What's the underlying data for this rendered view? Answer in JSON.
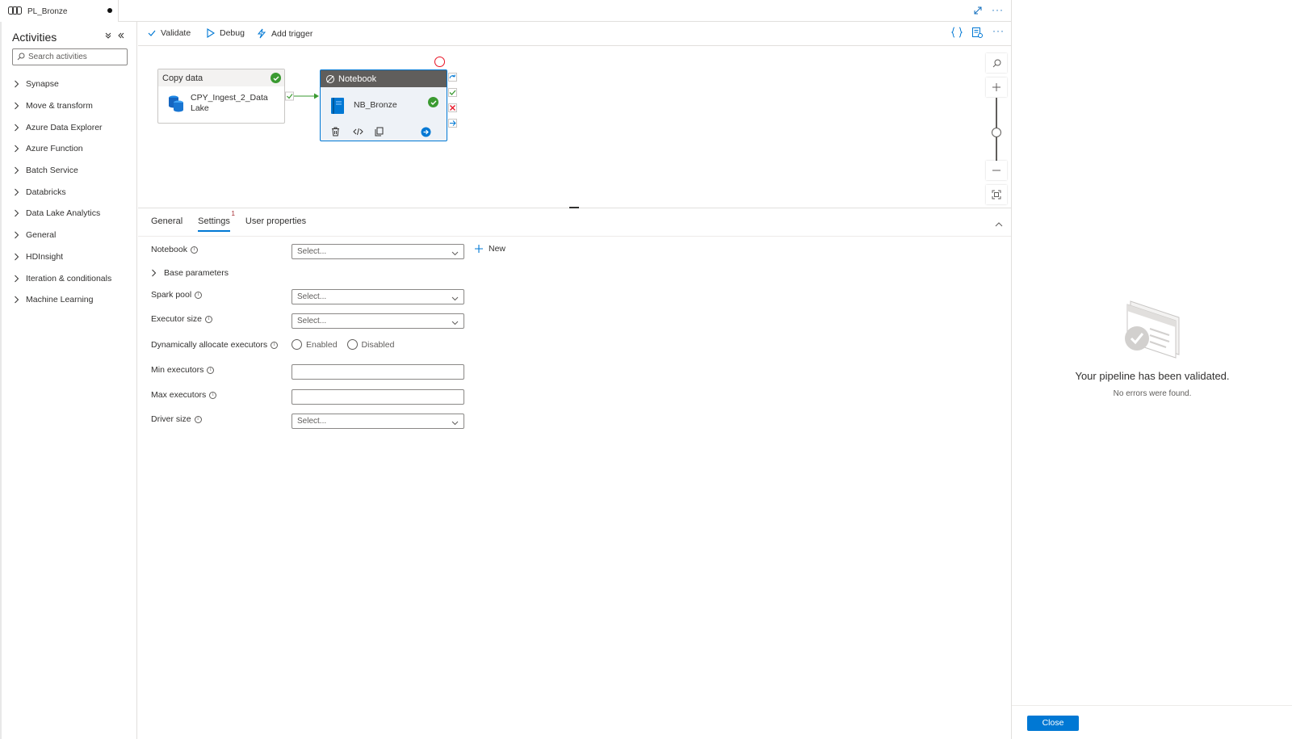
{
  "tab": {
    "name": "PL_Bronze"
  },
  "activities": {
    "title": "Activities",
    "search_placeholder": "Search activities",
    "groups": [
      "Synapse",
      "Move & transform",
      "Azure Data Explorer",
      "Azure Function",
      "Batch Service",
      "Databricks",
      "Data Lake Analytics",
      "General",
      "HDInsight",
      "Iteration & conditionals",
      "Machine Learning"
    ]
  },
  "toolbar": {
    "validate": "Validate",
    "debug": "Debug",
    "add_trigger": "Add trigger"
  },
  "canvas": {
    "copy_activity": {
      "type": "Copy data",
      "name": "CPY_Ingest_2_Data Lake"
    },
    "notebook_activity": {
      "type": "Notebook",
      "name": "NB_Bronze"
    }
  },
  "properties": {
    "tabs": {
      "general": "General",
      "settings": "Settings",
      "settings_errors": "1",
      "user_properties": "User properties"
    },
    "notebook_label": "Notebook",
    "notebook_value": "Select...",
    "new_label": "New",
    "base_parameters": "Base parameters",
    "spark_pool_label": "Spark pool",
    "spark_pool_value": "Select...",
    "executor_size_label": "Executor size",
    "executor_size_value": "Select...",
    "dyn_alloc_label": "Dynamically allocate executors",
    "enabled": "Enabled",
    "disabled": "Disabled",
    "min_executors_label": "Min executors",
    "min_executors_value": "",
    "max_executors_label": "Max executors",
    "max_executors_value": "",
    "driver_size_label": "Driver size",
    "driver_size_value": "Select..."
  },
  "validation": {
    "title": "Your pipeline has been validated.",
    "subtitle": "No errors were found.",
    "close": "Close"
  },
  "colors": {
    "accent": "#0078d4",
    "success": "#3a9a31",
    "error": "#e81123"
  }
}
